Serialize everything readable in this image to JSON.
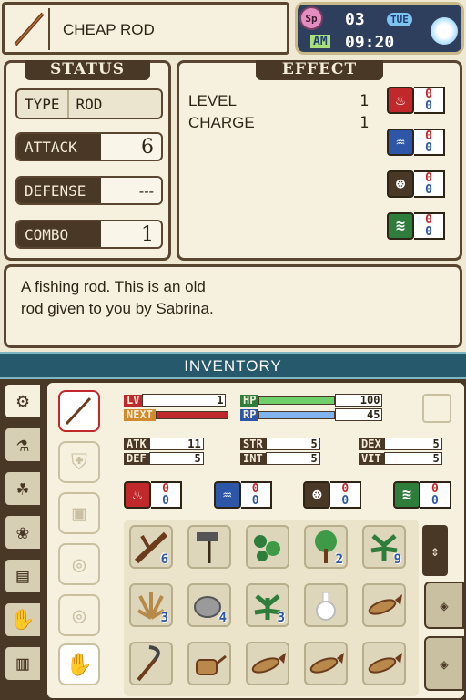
{
  "item": {
    "name": "CHEAP ROD",
    "icon": "fishing-rod-icon"
  },
  "clock": {
    "day": "03",
    "weekday": "TUE",
    "ampm": "AM",
    "time": "09:20",
    "season_icon": "sp-badge-icon",
    "weather_icon": "sun-icon"
  },
  "status": {
    "title": "STATUS",
    "type_label": "TYPE",
    "type_value": "ROD",
    "attack_label": "ATTACK",
    "attack_value": "6",
    "defense_label": "DEFENSE",
    "defense_value": "---",
    "combo_label": "COMBO",
    "combo_value": "1"
  },
  "effect": {
    "title": "EFFECT",
    "level_label": "LEVEL",
    "level_value": "1",
    "charge_label": "CHARGE",
    "charge_value": "1",
    "elements": [
      {
        "icon": "fire-element-icon",
        "color": "#c0282b",
        "a": "0",
        "b": "0"
      },
      {
        "icon": "water-element-icon",
        "color": "#2d56a8",
        "a": "0",
        "b": "0"
      },
      {
        "icon": "earth-element-icon",
        "color": "#4a3826",
        "a": "0",
        "b": "0"
      },
      {
        "icon": "wind-element-icon",
        "color": "#2f7d3a",
        "a": "0",
        "b": "0"
      }
    ]
  },
  "description": {
    "line1": "A fishing rod. This is an old",
    "line2": "rod given to you by Sabrina."
  },
  "inventory": {
    "title": "INVENTORY",
    "stats": {
      "lv_label": "LV",
      "lv": "1",
      "next_label": "NEXT",
      "hp_label": "HP",
      "hp": "100",
      "rp_label": "RP",
      "rp": "45",
      "atk_label": "ATK",
      "atk": "11",
      "def_label": "DEF",
      "def": "5",
      "str_label": "STR",
      "str": "5",
      "int_label": "INT",
      "int": "5",
      "dex_label": "DEX",
      "dex": "5",
      "vit_label": "VIT",
      "vit": "5"
    },
    "elements": [
      {
        "a": "0",
        "b": "0"
      },
      {
        "a": "0",
        "b": "0"
      },
      {
        "a": "0",
        "b": "0"
      },
      {
        "a": "0",
        "b": "0"
      }
    ],
    "items": [
      {
        "icon": "branch-icon",
        "count": "6"
      },
      {
        "icon": "hoe-icon",
        "count": ""
      },
      {
        "icon": "weed-icon",
        "count": ""
      },
      {
        "icon": "tree-sapling-icon",
        "count": "2"
      },
      {
        "icon": "herb-icon",
        "count": "9"
      },
      {
        "icon": "withered-grass-icon",
        "count": "3"
      },
      {
        "icon": "stone-icon",
        "count": "4"
      },
      {
        "icon": "green-grass-icon",
        "count": "3"
      },
      {
        "icon": "bottle-icon",
        "count": ""
      },
      {
        "icon": "fish-icon",
        "count": ""
      },
      {
        "icon": "sickle-icon",
        "count": ""
      },
      {
        "icon": "watering-can-icon",
        "count": ""
      },
      {
        "icon": "fish-icon",
        "count": ""
      },
      {
        "icon": "fish-icon",
        "count": ""
      },
      {
        "icon": "fish-icon",
        "count": ""
      }
    ]
  }
}
